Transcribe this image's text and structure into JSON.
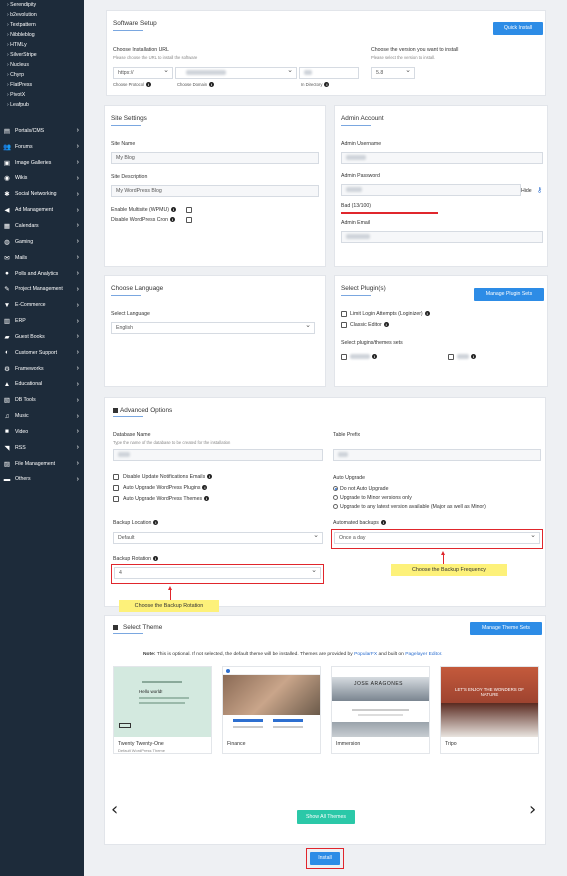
{
  "sidebar": {
    "subitems": [
      "Serendipity",
      "b2evolution",
      "Textpattern",
      "Nibbleblog",
      "HTMLy",
      "SilverStripe",
      "Nucleus",
      "Chyrp",
      "FlatPress",
      "PivotX",
      "Leafpub"
    ],
    "categories": [
      {
        "label": "Portals/CMS",
        "icon": "▤"
      },
      {
        "label": "Forums",
        "icon": "👥"
      },
      {
        "label": "Image Galleries",
        "icon": "▣"
      },
      {
        "label": "Wikis",
        "icon": "◉"
      },
      {
        "label": "Social Networking",
        "icon": "✱"
      },
      {
        "label": "Ad Management",
        "icon": "◀"
      },
      {
        "label": "Calendars",
        "icon": "▦"
      },
      {
        "label": "Gaming",
        "icon": "◍"
      },
      {
        "label": "Mails",
        "icon": "✉"
      },
      {
        "label": "Polls and Analytics",
        "icon": "●"
      },
      {
        "label": "Project Management",
        "icon": "✎"
      },
      {
        "label": "E-Commerce",
        "icon": "▼"
      },
      {
        "label": "ERP",
        "icon": "▥"
      },
      {
        "label": "Guest Books",
        "icon": "▰"
      },
      {
        "label": "Customer Support",
        "icon": "◐"
      },
      {
        "label": "Frameworks",
        "icon": "⚙"
      },
      {
        "label": "Educational",
        "icon": "▲"
      },
      {
        "label": "DB Tools",
        "icon": "▧"
      },
      {
        "label": "Music",
        "icon": "♫"
      },
      {
        "label": "Video",
        "icon": "■"
      },
      {
        "label": "RSS",
        "icon": "◥"
      },
      {
        "label": "File Management",
        "icon": "▨"
      },
      {
        "label": "Others",
        "icon": "▬"
      }
    ]
  },
  "software_setup": {
    "title": "Software Setup",
    "quick_install": "Quick Install",
    "choose_url_label": "Choose Installation URL",
    "choose_url_hint": "Please choose the URL to install the software",
    "protocol_value": "https://",
    "protocol_label": "Choose Protocol",
    "domain_label": "Choose Domain",
    "directory_label": "In Directory",
    "version_label": "Choose the version you want to install",
    "version_hint": "Please select the version to install.",
    "version_value": "5.8"
  },
  "site_settings": {
    "title": "Site Settings",
    "site_name_label": "Site Name",
    "site_name_value": "My Blog",
    "site_desc_label": "Site Description",
    "site_desc_value": "My WordPress Blog",
    "multisite_label": "Enable Multisite (WPMU)",
    "disable_cron_label": "Disable WordPress Cron"
  },
  "admin_account": {
    "title": "Admin Account",
    "username_label": "Admin Username",
    "password_label": "Admin Password",
    "hide_label": "Hide",
    "strength_label": "Bad (13/100)",
    "email_label": "Admin Email"
  },
  "choose_language": {
    "title": "Choose Language",
    "select_label": "Select Language",
    "language_value": "English"
  },
  "select_plugins": {
    "title": "Select Plugin(s)",
    "manage_button": "Manage Plugin Sets",
    "plugin1": "Limit Login Attempts (Loginizer)",
    "plugin2": "Classic Editor",
    "sets_label": "Select plugins/themes sets"
  },
  "advanced": {
    "title": "Advanced Options",
    "db_name_label": "Database Name",
    "db_name_hint": "Type the name of the database to be created for the installation",
    "table_prefix_label": "Table Prefix",
    "disable_notif_label": "Disable Update Notifications Emails",
    "auto_plugins_label": "Auto Upgrade WordPress Plugins",
    "auto_themes_label": "Auto Upgrade WordPress Themes",
    "auto_upgrade_label": "Auto Upgrade",
    "upgrade_opt1": "Do not Auto Upgrade",
    "upgrade_opt2": "Upgrade to Minor versions only",
    "upgrade_opt3": "Upgrade to any latest version available (Major as well as Minor)",
    "backup_location_label": "Backup Location",
    "backup_location_value": "Default",
    "automated_backups_label": "Automated backups",
    "automated_backups_value": "Once a day",
    "backup_rotation_label": "Backup Rotation",
    "backup_rotation_value": "4",
    "callout_frequency": "Choose the Backup Frequency",
    "callout_rotation": "Choose the Backup Rotation"
  },
  "select_theme": {
    "title": "Select Theme",
    "manage_button": "Manage Theme Sets",
    "note_bold": "Note:",
    "note_text": "This is optional. If not selected, the default theme will be installed. Themes are provided by",
    "popularfx": "PopularFX",
    "note_mid": "and built on",
    "pagelayer": "Pagelayer Editor.",
    "themes": [
      {
        "name": "Twenty Twenty-One",
        "sub": "Default WordPress Theme"
      },
      {
        "name": "Finance",
        "sub": ""
      },
      {
        "name": "Immersion",
        "sub": ""
      },
      {
        "name": "Tripo",
        "sub": ""
      }
    ],
    "card_text": {
      "hello": "Hello world!",
      "jose": "JOSE ARAGONES",
      "lets": "LET'S ENJOY THE WONDERS OF NATURE"
    },
    "show_all": "Show All Themes",
    "prev": "‹",
    "next": "›"
  },
  "install_button": "Install"
}
